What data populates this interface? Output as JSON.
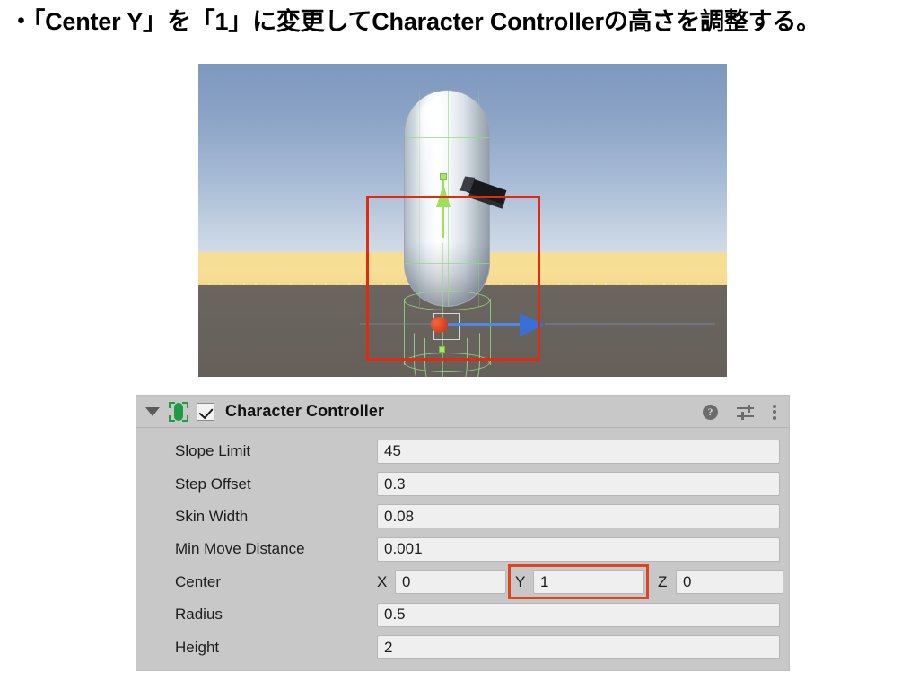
{
  "instruction": {
    "bullet": "・",
    "text": "「Center Y」を「1」に変更してCharacter Controllerの高さを調整する。"
  },
  "scene_view": {
    "name": "unity-scene-view",
    "objects": [
      "capsule-character",
      "camera-child-object",
      "character-controller-wireframe"
    ],
    "gizmo": {
      "x_axis_color": "#c03010",
      "y_axis_color": "#9ee05a",
      "z_axis_color": "#3a6fd8"
    },
    "annotation_rect_color": "#e02b13",
    "sky_color": "#8ba3c6",
    "sand_color": "#f6dd93",
    "ground_color": "#6b6560"
  },
  "inspector": {
    "component_title": "Character Controller",
    "component_enabled": true,
    "icons": {
      "foldout": "triangle-down-icon",
      "component": "character-controller-icon",
      "help": "?",
      "preset": "preset-icon",
      "menu": "kebab-menu-icon"
    },
    "properties": [
      {
        "label": "Slope Limit",
        "value": "45"
      },
      {
        "label": "Step Offset",
        "value": "0.3"
      },
      {
        "label": "Skin Width",
        "value": "0.08"
      },
      {
        "label": "Min Move Distance",
        "value": "0.001"
      }
    ],
    "center": {
      "label": "Center",
      "x_label": "X",
      "x_value": "0",
      "y_label": "Y",
      "y_value": "1",
      "z_label": "Z",
      "z_value": "0",
      "highlighted_axis": "Y",
      "highlight_color": "#e0431f"
    },
    "radius": {
      "label": "Radius",
      "value": "0.5"
    },
    "height": {
      "label": "Height",
      "value": "2"
    },
    "panel_background": "#c8c8c8",
    "field_background": "#efeff0"
  }
}
